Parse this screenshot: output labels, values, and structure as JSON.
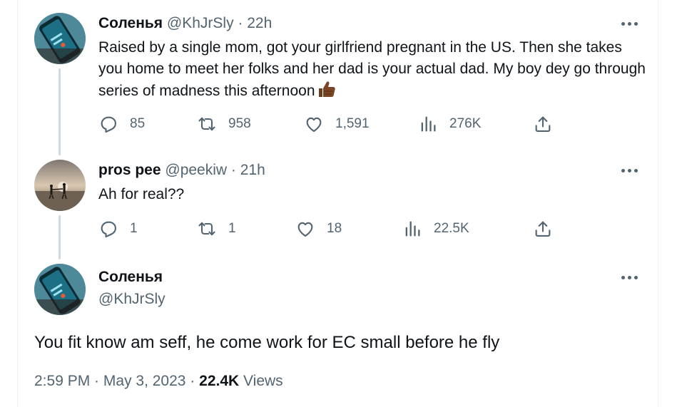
{
  "tweets": [
    {
      "name": "Соленья",
      "handle": "@KhJrSly",
      "separator": " · ",
      "time": "22h",
      "text": "Raised by a single mom, got your girlfriend pregnant in the US. Then she takes you home to meet her folks and her dad is your actual dad. My boy dey go through series of madness this afternoon",
      "emoji": "thumbs-up-dark-skin",
      "replies": "85",
      "retweets": "958",
      "likes": "1,591",
      "views": "276K"
    },
    {
      "name": "pros pee",
      "handle": "@peekiw",
      "separator": " · ",
      "time": "21h",
      "text": "Ah for real??",
      "replies": "1",
      "retweets": "1",
      "likes": "18",
      "views": "22.5K"
    }
  ],
  "main_tweet": {
    "name": "Соленья",
    "handle": "@KhJrSly",
    "text": "You fit know am seff, he come work for EC small before he fly",
    "time": "2:59 PM",
    "separator": " · ",
    "date": "May 3, 2023",
    "views_count": "22.4K",
    "views_label": " Views"
  },
  "colors": {
    "text_primary": "#0f1419",
    "text_secondary": "#536471",
    "thread_line": "#cfd9de",
    "border": "#eff3f4"
  }
}
